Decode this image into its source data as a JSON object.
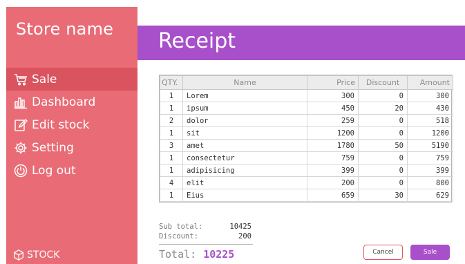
{
  "sidebar": {
    "store_name": "Store name",
    "items": [
      {
        "label": "Sale",
        "icon": "cart-icon",
        "active": true
      },
      {
        "label": "Dashboard",
        "icon": "bar-chart-icon",
        "active": false
      },
      {
        "label": "Edit stock",
        "icon": "edit-icon",
        "active": false
      },
      {
        "label": "Setting",
        "icon": "gear-icon",
        "active": false
      },
      {
        "label": "Log out",
        "icon": "power-icon",
        "active": false
      }
    ],
    "footer_label": "STOCK"
  },
  "header": {
    "title": "Receipt"
  },
  "table": {
    "columns": [
      "QTY.",
      "Name",
      "Price",
      "Discount",
      "Amount"
    ],
    "rows": [
      {
        "qty": "1",
        "name": "Lorem",
        "price": "300",
        "discount": "0",
        "amount": "300"
      },
      {
        "qty": "1",
        "name": "ipsum",
        "price": "450",
        "discount": "20",
        "amount": "430"
      },
      {
        "qty": "2",
        "name": "dolor",
        "price": "259",
        "discount": "0",
        "amount": "518"
      },
      {
        "qty": "1",
        "name": "sit",
        "price": "1200",
        "discount": "0",
        "amount": "1200"
      },
      {
        "qty": "3",
        "name": "amet",
        "price": "1780",
        "discount": "50",
        "amount": "5190"
      },
      {
        "qty": "1",
        "name": "consectetur",
        "price": "759",
        "discount": "0",
        "amount": "759"
      },
      {
        "qty": "1",
        "name": "adipisicing",
        "price": "399",
        "discount": "0",
        "amount": "399"
      },
      {
        "qty": "4",
        "name": "elit",
        "price": "200",
        "discount": "0",
        "amount": "800"
      },
      {
        "qty": "1",
        "name": "Eius",
        "price": "659",
        "discount": "30",
        "amount": "629"
      }
    ]
  },
  "summary": {
    "subtotal_label": "Sub total:",
    "subtotal_value": "10425",
    "discount_label": "Discount:",
    "discount_value": "200",
    "total_label": "Total:",
    "total_value": "10225"
  },
  "actions": {
    "cancel_label": "Cancel",
    "sale_label": "Sale"
  },
  "colors": {
    "sidebar": "#e96b75",
    "sidebar_active": "#d9545e",
    "accent": "#a84fca",
    "cancel_border": "#e05560"
  }
}
